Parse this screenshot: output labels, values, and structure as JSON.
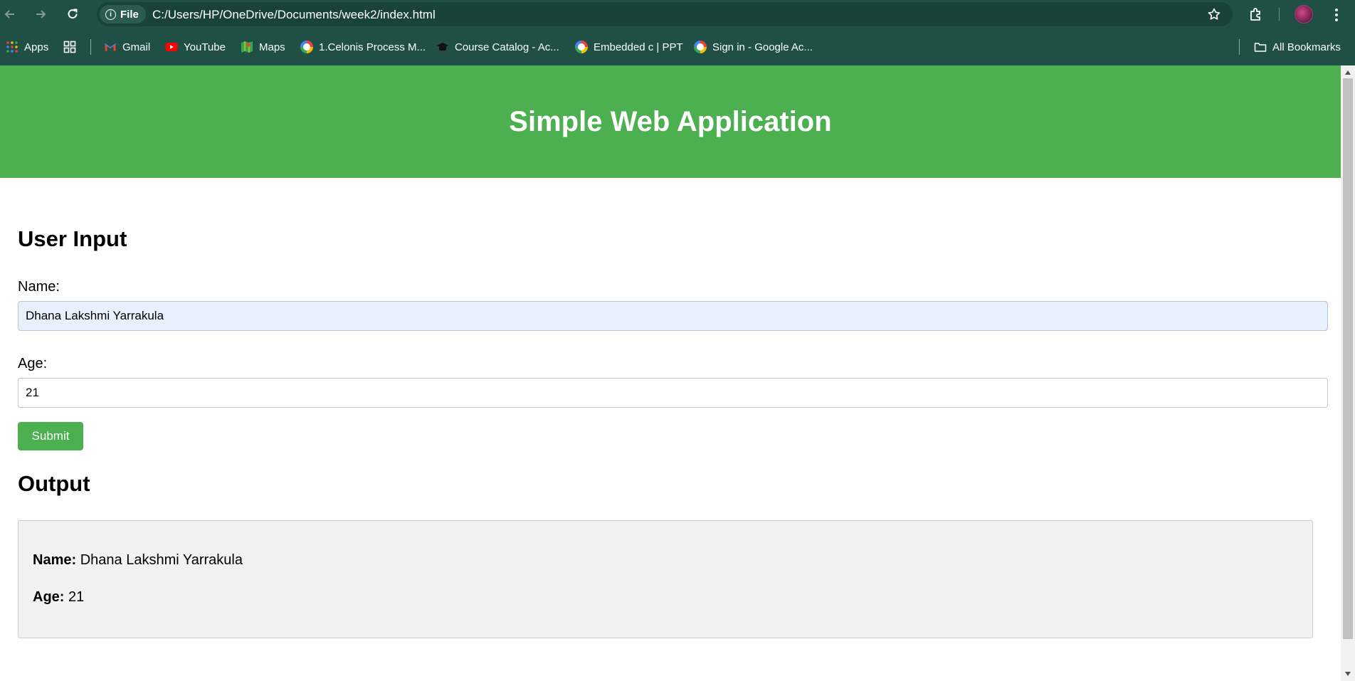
{
  "browser": {
    "address": {
      "scheme_label": "File",
      "url": "C:/Users/HP/OneDrive/Documents/week2/index.html"
    },
    "bookmarks": [
      {
        "label": "Apps",
        "icon": "apps-grid-icon"
      },
      {
        "label": "Gmail",
        "icon": "gmail-icon"
      },
      {
        "label": "YouTube",
        "icon": "youtube-icon"
      },
      {
        "label": "Maps",
        "icon": "maps-icon"
      },
      {
        "label": "1.Celonis Process M...",
        "icon": "google-icon"
      },
      {
        "label": "Course Catalog - Ac...",
        "icon": "graduation-cap-icon"
      },
      {
        "label": "Embedded c | PPT",
        "icon": "google-icon"
      },
      {
        "label": "Sign in - Google Ac...",
        "icon": "google-icon"
      }
    ],
    "all_bookmarks_label": "All Bookmarks"
  },
  "page": {
    "header_title": "Simple Web Application",
    "input_section": {
      "heading": "User Input",
      "name_label": "Name:",
      "name_value": "Dhana Lakshmi Yarrakula",
      "age_label": "Age:",
      "age_value": "21",
      "submit_label": "Submit"
    },
    "output_section": {
      "heading": "Output",
      "name_key": "Name:",
      "name_value": "Dhana Lakshmi Yarrakula",
      "age_key": "Age:",
      "age_value": "21"
    }
  },
  "colors": {
    "header_green": "#4caf50",
    "chrome_dark_green": "#1f4f45",
    "autofill_blue": "#e8f0fe",
    "output_bg": "#f2f2f2"
  }
}
